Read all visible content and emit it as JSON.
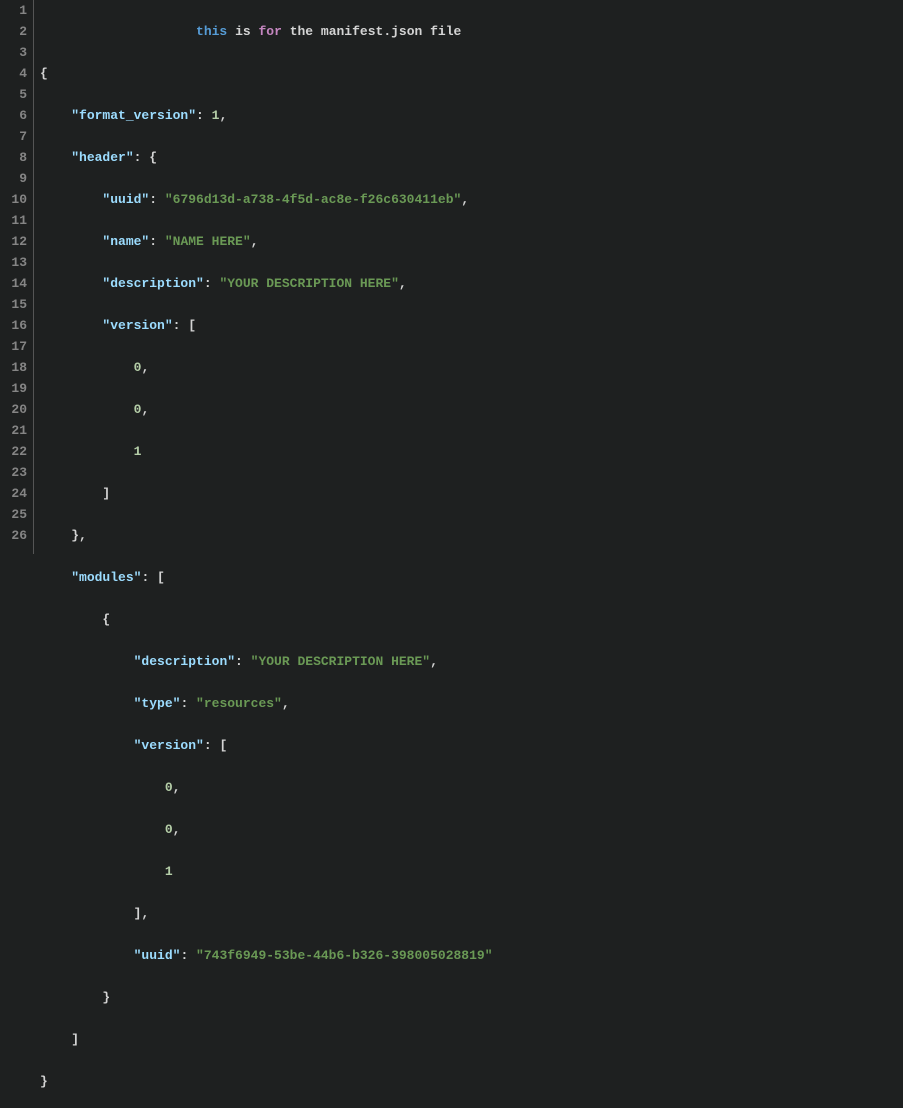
{
  "comment": {
    "word1": "this",
    "word2": "is",
    "word3": "for",
    "rest": "the manifest.json file"
  },
  "keys": {
    "format_version": "\"format_version\"",
    "header": "\"header\"",
    "uuid": "\"uuid\"",
    "name": "\"name\"",
    "description": "\"description\"",
    "version": "\"version\"",
    "modules": "\"modules\"",
    "type": "\"type\""
  },
  "values": {
    "format_version": "1",
    "header_uuid": "\"6796d13d-a738-4f5d-ac8e-f26c630411eb\"",
    "header_name": "\"NAME HERE\"",
    "header_description": "\"YOUR DESCRIPTION HERE\"",
    "v0": "0",
    "v1": "0",
    "v2": "1",
    "mod_description": "\"YOUR DESCRIPTION HERE\"",
    "mod_type": "\"resources\"",
    "mv0": "0",
    "mv1": "0",
    "mv2": "1",
    "mod_uuid": "\"743f6949-53be-44b6-b326-398005028819\""
  },
  "linecount": 26,
  "chart_data": null,
  "manifest_json": {
    "format_version": 1,
    "header": {
      "uuid": "6796d13d-a738-4f5d-ac8e-f26c630411eb",
      "name": "NAME HERE",
      "description": "YOUR DESCRIPTION HERE",
      "version": [
        0,
        0,
        1
      ]
    },
    "modules": [
      {
        "description": "YOUR DESCRIPTION HERE",
        "type": "resources",
        "version": [
          0,
          0,
          1
        ],
        "uuid": "743f6949-53be-44b6-b326-398005028819"
      }
    ]
  }
}
